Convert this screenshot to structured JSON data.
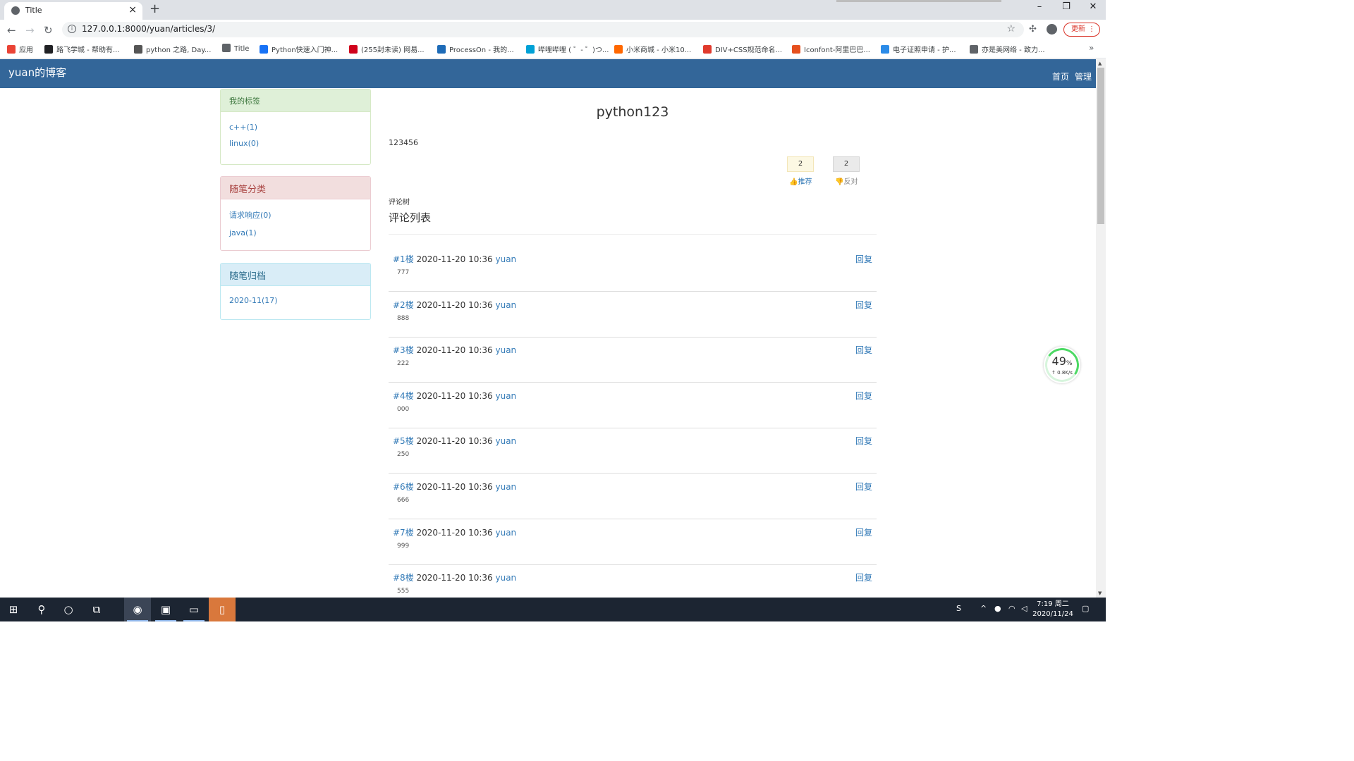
{
  "browser": {
    "tab_title": "Title",
    "tab_close": "×",
    "new_tab": "+",
    "window_buttons": [
      "–",
      "❐",
      "✕"
    ],
    "url": "127.0.0.1:8000/yuan/articles/3/",
    "update_label": "更新",
    "bookmarks": [
      {
        "label": "应用",
        "icon": "apps-grid-icon",
        "color": "#ea4335"
      },
      {
        "label": "路飞学城 - 帮助有...",
        "icon": "luffy-icon",
        "color": "#202124"
      },
      {
        "label": "python 之路, Day...",
        "icon": "python-road-icon",
        "color": "#555555"
      },
      {
        "label": "Title",
        "icon": "globe-icon",
        "color": "#5f6368"
      },
      {
        "label": "Python快速入门神...",
        "icon": "zhihu-icon",
        "color": "#1772f6"
      },
      {
        "label": "(255封未读) 网易...",
        "icon": "netease-mail-icon",
        "color": "#d0021b"
      },
      {
        "label": "ProcessOn - 我的...",
        "icon": "processon-icon",
        "color": "#1d6bb7"
      },
      {
        "label": "哔哩哔哩 ( ゜- ゜)つ...",
        "icon": "bilibili-icon",
        "color": "#00a1d6"
      },
      {
        "label": "小米商城 - 小米10...",
        "icon": "mi-icon",
        "color": "#ff6700"
      },
      {
        "label": "DIV+CSS规范命名...",
        "icon": "div-css-icon",
        "color": "#e03a2d"
      },
      {
        "label": "Iconfont-阿里巴巴...",
        "icon": "iconfont-icon",
        "color": "#e6501e"
      },
      {
        "label": "电子证照申请 - 护...",
        "icon": "certificate-icon",
        "color": "#2b8be8"
      },
      {
        "label": "亦是美网络 - 致力...",
        "icon": "globe-icon",
        "color": "#5f6368"
      }
    ],
    "bookmarks_more": "»"
  },
  "site": {
    "brand": "yuan的博客",
    "nav": [
      "首页",
      "管理"
    ]
  },
  "sidebar": {
    "tags": {
      "title": "我的标签",
      "items": [
        "c++(1)",
        "linux(0)"
      ]
    },
    "categories": {
      "title": "随笔分类",
      "items": [
        "请求响应(0)",
        "java(1)"
      ]
    },
    "archive": {
      "title": "随笔归档",
      "items": [
        "2020-11(17)"
      ]
    }
  },
  "article": {
    "title": "python123",
    "body": "123456",
    "digg": {
      "count": "2",
      "label": "推荐"
    },
    "bury": {
      "count": "2",
      "label": "反对"
    },
    "tree_label": "评论树",
    "list_title": "评论列表"
  },
  "comments": [
    {
      "floor": "#1楼",
      "time": "2020-11-20 10:36",
      "user": "yuan",
      "reply": "回复",
      "content": "777"
    },
    {
      "floor": "#2楼",
      "time": "2020-11-20 10:36",
      "user": "yuan",
      "reply": "回复",
      "content": "888"
    },
    {
      "floor": "#3楼",
      "time": "2020-11-20 10:36",
      "user": "yuan",
      "reply": "回复",
      "content": "222"
    },
    {
      "floor": "#4楼",
      "time": "2020-11-20 10:36",
      "user": "yuan",
      "reply": "回复",
      "content": "000"
    },
    {
      "floor": "#5楼",
      "time": "2020-11-20 10:36",
      "user": "yuan",
      "reply": "回复",
      "content": "250"
    },
    {
      "floor": "#6楼",
      "time": "2020-11-20 10:36",
      "user": "yuan",
      "reply": "回复",
      "content": "666"
    },
    {
      "floor": "#7楼",
      "time": "2020-11-20 10:36",
      "user": "yuan",
      "reply": "回复",
      "content": "999"
    },
    {
      "floor": "#8楼",
      "time": "2020-11-20 10:36",
      "user": "yuan",
      "reply": "回复",
      "content": "555"
    }
  ],
  "net_widget": {
    "percent": "49",
    "percent_unit": "%",
    "speed": "↑ 0.8K/s"
  },
  "taskbar": {
    "apps": [
      "start-icon",
      "search-icon",
      "cortana-icon",
      "task-view-icon",
      "chrome-icon",
      "pycharm-icon",
      "file-explorer-icon",
      "phone-app-icon"
    ],
    "time": "7:19 周二",
    "date": "2020/11/24"
  }
}
